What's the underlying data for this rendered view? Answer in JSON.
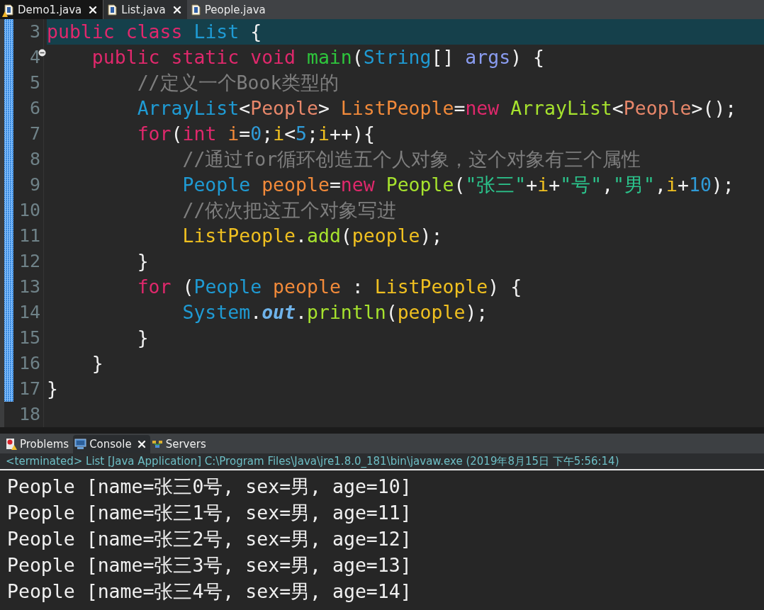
{
  "editor_tabs": [
    {
      "label": "Demo1.java",
      "selected": false,
      "closable": true,
      "warning": true
    },
    {
      "label": "List.java",
      "selected": true,
      "closable": true,
      "warning": false
    },
    {
      "label": "People.java",
      "selected": false,
      "closable": false,
      "warning": false
    }
  ],
  "code_lines": [
    {
      "number": "3",
      "current": true,
      "changed": true,
      "fold": false,
      "tokens": [
        {
          "kind": "keyword",
          "text": "public class "
        },
        {
          "kind": "type",
          "text": "List "
        },
        {
          "kind": "plain",
          "text": "{"
        }
      ]
    },
    {
      "number": "4",
      "current": false,
      "changed": true,
      "fold": true,
      "tokens": [
        {
          "kind": "keyword",
          "text": "    public static void "
        },
        {
          "kind": "method-decl",
          "text": "main"
        },
        {
          "kind": "plain",
          "text": "("
        },
        {
          "kind": "type",
          "text": "String"
        },
        {
          "kind": "plain",
          "text": "[] "
        },
        {
          "kind": "param",
          "text": "args"
        },
        {
          "kind": "plain",
          "text": ") {"
        }
      ]
    },
    {
      "number": "5",
      "current": false,
      "changed": true,
      "fold": false,
      "tokens": [
        {
          "kind": "comment",
          "text": "        //定义一个Book类型的"
        }
      ]
    },
    {
      "number": "6",
      "current": false,
      "changed": true,
      "fold": false,
      "tokens": [
        {
          "kind": "type",
          "text": "        ArrayList"
        },
        {
          "kind": "plain",
          "text": "<"
        },
        {
          "kind": "type-arg",
          "text": "People"
        },
        {
          "kind": "plain",
          "text": "> "
        },
        {
          "kind": "local-decl",
          "text": "ListPeople"
        },
        {
          "kind": "plain",
          "text": "="
        },
        {
          "kind": "keyword",
          "text": "new "
        },
        {
          "kind": "method",
          "text": "ArrayList"
        },
        {
          "kind": "plain",
          "text": "<"
        },
        {
          "kind": "type-arg",
          "text": "People"
        },
        {
          "kind": "plain",
          "text": ">();"
        }
      ]
    },
    {
      "number": "7",
      "current": false,
      "changed": true,
      "fold": false,
      "tokens": [
        {
          "kind": "keyword",
          "text": "        for"
        },
        {
          "kind": "plain",
          "text": "("
        },
        {
          "kind": "keyword",
          "text": "int "
        },
        {
          "kind": "local-decl",
          "text": "i"
        },
        {
          "kind": "plain",
          "text": "="
        },
        {
          "kind": "number",
          "text": "0"
        },
        {
          "kind": "plain",
          "text": ";"
        },
        {
          "kind": "local",
          "text": "i"
        },
        {
          "kind": "plain",
          "text": "<"
        },
        {
          "kind": "number",
          "text": "5"
        },
        {
          "kind": "plain",
          "text": ";"
        },
        {
          "kind": "local",
          "text": "i"
        },
        {
          "kind": "plain",
          "text": "++){"
        }
      ]
    },
    {
      "number": "8",
      "current": false,
      "changed": true,
      "fold": false,
      "tokens": [
        {
          "kind": "comment",
          "text": "            //通过for循环创造五个人对象，这个对象有三个属性"
        }
      ]
    },
    {
      "number": "9",
      "current": false,
      "changed": true,
      "fold": false,
      "tokens": [
        {
          "kind": "type",
          "text": "            People "
        },
        {
          "kind": "local-decl",
          "text": "people"
        },
        {
          "kind": "plain",
          "text": "="
        },
        {
          "kind": "keyword",
          "text": "new "
        },
        {
          "kind": "method",
          "text": "People"
        },
        {
          "kind": "plain",
          "text": "("
        },
        {
          "kind": "string",
          "text": "\"张三\""
        },
        {
          "kind": "plain",
          "text": "+"
        },
        {
          "kind": "local",
          "text": "i"
        },
        {
          "kind": "plain",
          "text": "+"
        },
        {
          "kind": "string",
          "text": "\"号\""
        },
        {
          "kind": "plain",
          "text": ","
        },
        {
          "kind": "string",
          "text": "\"男\""
        },
        {
          "kind": "plain",
          "text": ","
        },
        {
          "kind": "local",
          "text": "i"
        },
        {
          "kind": "plain",
          "text": "+"
        },
        {
          "kind": "number",
          "text": "10"
        },
        {
          "kind": "plain",
          "text": ");"
        }
      ]
    },
    {
      "number": "10",
      "current": false,
      "changed": true,
      "fold": false,
      "tokens": [
        {
          "kind": "comment",
          "text": "            //依次把这五个对象写进"
        }
      ]
    },
    {
      "number": "11",
      "current": false,
      "changed": true,
      "fold": false,
      "tokens": [
        {
          "kind": "local",
          "text": "            ListPeople"
        },
        {
          "kind": "plain",
          "text": "."
        },
        {
          "kind": "method",
          "text": "add"
        },
        {
          "kind": "plain",
          "text": "("
        },
        {
          "kind": "local",
          "text": "people"
        },
        {
          "kind": "plain",
          "text": ");"
        }
      ]
    },
    {
      "number": "12",
      "current": false,
      "changed": true,
      "fold": false,
      "tokens": [
        {
          "kind": "plain",
          "text": "        }"
        }
      ]
    },
    {
      "number": "13",
      "current": false,
      "changed": true,
      "fold": false,
      "tokens": [
        {
          "kind": "keyword",
          "text": "        for "
        },
        {
          "kind": "plain",
          "text": "("
        },
        {
          "kind": "type",
          "text": "People "
        },
        {
          "kind": "local-decl",
          "text": "people "
        },
        {
          "kind": "plain",
          "text": ": "
        },
        {
          "kind": "local",
          "text": "ListPeople"
        },
        {
          "kind": "plain",
          "text": ") {"
        }
      ]
    },
    {
      "number": "14",
      "current": false,
      "changed": true,
      "fold": false,
      "tokens": [
        {
          "kind": "type",
          "text": "            System"
        },
        {
          "kind": "plain",
          "text": "."
        },
        {
          "kind": "static-field",
          "text": "out"
        },
        {
          "kind": "plain",
          "text": "."
        },
        {
          "kind": "method",
          "text": "println"
        },
        {
          "kind": "plain",
          "text": "("
        },
        {
          "kind": "local",
          "text": "people"
        },
        {
          "kind": "plain",
          "text": ");"
        }
      ]
    },
    {
      "number": "15",
      "current": false,
      "changed": true,
      "fold": false,
      "tokens": [
        {
          "kind": "plain",
          "text": "        }"
        }
      ]
    },
    {
      "number": "16",
      "current": false,
      "changed": true,
      "fold": false,
      "tokens": [
        {
          "kind": "plain",
          "text": "    }"
        }
      ]
    },
    {
      "number": "17",
      "current": false,
      "changed": true,
      "fold": false,
      "tokens": [
        {
          "kind": "plain",
          "text": "}"
        }
      ]
    },
    {
      "number": "18",
      "current": false,
      "changed": false,
      "fold": false
    }
  ],
  "console_tabs": [
    {
      "label": "Problems",
      "kind": "problems",
      "selected": false,
      "closable": false
    },
    {
      "label": "Console",
      "kind": "console",
      "selected": true,
      "closable": true
    },
    {
      "label": "Servers",
      "kind": "servers",
      "selected": false,
      "closable": false
    }
  ],
  "console_status": "<terminated> List [Java Application] C:\\Program Files\\Java\\jre1.8.0_181\\bin\\javaw.exe (2019年8月15日 下午5:56:14)",
  "console_output": [
    "People [name=张三0号, sex=男, age=10]",
    "People [name=张三1号, sex=男, age=11]",
    "People [name=张三2号, sex=男, age=12]",
    "People [name=张三3号, sex=男, age=13]",
    "People [name=张三4号, sex=男, age=14]"
  ]
}
